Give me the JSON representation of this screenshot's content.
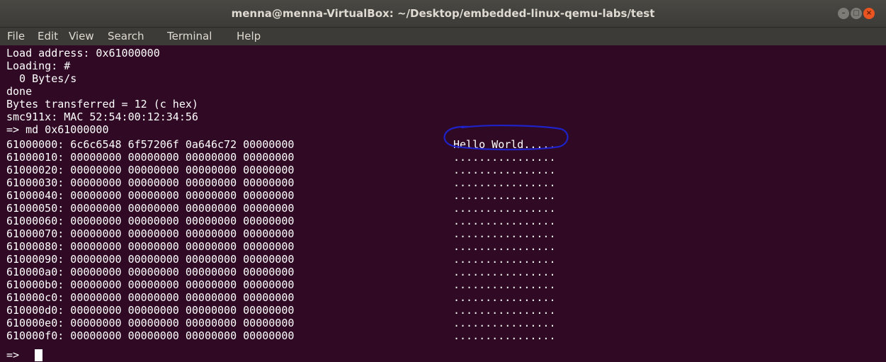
{
  "window": {
    "title": "menna@menna-VirtualBox: ~/Desktop/embedded-linux-qemu-labs/test",
    "buttons": {
      "minimize": "–",
      "maximize": "□",
      "close": "×"
    }
  },
  "menubar": {
    "items": [
      "File",
      "Edit",
      "View",
      "Search",
      "Terminal",
      "Help"
    ]
  },
  "terminal": {
    "intro_lines": [
      "Load address: 0x61000000",
      "Loading: #",
      "  0 Bytes/s",
      "done",
      "Bytes transferred = 12 (c hex)",
      "smc911x: MAC 52:54:00:12:34:56",
      "=> md 0x61000000"
    ],
    "dump_rows": [
      {
        "hex": "61000000: 6c6c6548 6f57206f 0a646c72 00000000",
        "ascii": "Hello World....."
      },
      {
        "hex": "61000010: 00000000 00000000 00000000 00000000",
        "ascii": "................"
      },
      {
        "hex": "61000020: 00000000 00000000 00000000 00000000",
        "ascii": "................"
      },
      {
        "hex": "61000030: 00000000 00000000 00000000 00000000",
        "ascii": "................"
      },
      {
        "hex": "61000040: 00000000 00000000 00000000 00000000",
        "ascii": "................"
      },
      {
        "hex": "61000050: 00000000 00000000 00000000 00000000",
        "ascii": "................"
      },
      {
        "hex": "61000060: 00000000 00000000 00000000 00000000",
        "ascii": "................"
      },
      {
        "hex": "61000070: 00000000 00000000 00000000 00000000",
        "ascii": "................"
      },
      {
        "hex": "61000080: 00000000 00000000 00000000 00000000",
        "ascii": "................"
      },
      {
        "hex": "61000090: 00000000 00000000 00000000 00000000",
        "ascii": "................"
      },
      {
        "hex": "610000a0: 00000000 00000000 00000000 00000000",
        "ascii": "................"
      },
      {
        "hex": "610000b0: 00000000 00000000 00000000 00000000",
        "ascii": "................"
      },
      {
        "hex": "610000c0: 00000000 00000000 00000000 00000000",
        "ascii": "................"
      },
      {
        "hex": "610000d0: 00000000 00000000 00000000 00000000",
        "ascii": "................"
      },
      {
        "hex": "610000e0: 00000000 00000000 00000000 00000000",
        "ascii": "................"
      },
      {
        "hex": "610000f0: 00000000 00000000 00000000 00000000",
        "ascii": "................"
      }
    ],
    "prompt": "=>"
  },
  "colors": {
    "terminal_background": "#300a24",
    "titlebar": "#3c3b37",
    "close_button": "#e95420",
    "annotation_ink": "#1e22c8"
  }
}
